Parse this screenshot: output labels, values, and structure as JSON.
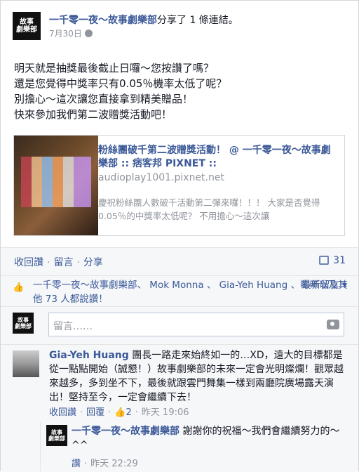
{
  "post": {
    "page_name": "一千零一夜～故事劇樂部",
    "shared_text": "分享了 1 條連結。",
    "date": "7月30日",
    "avatar_text": "故事\n劇樂部",
    "message_lines": [
      "明天就是抽獎最後截止日囉～您按讚了嗎？",
      "還是您覺得中獎率只有0.05％機率太低了呢？",
      "別擔心～這次讓您直接拿到精美贈品！",
      "快來參加我們第二波贈獎活動吧！"
    ]
  },
  "attachment": {
    "title": "粉絲團破千第二波贈獎活動！ @ 一千零一夜～故事劇樂部 :: 痞客邦 PIXNET ::",
    "url": "audioplay1001.pixnet.net",
    "description": "慶祝粉絲團人數破千活動第二彈來囉！！！ 大家是否覺得0.05％的中獎率太低呢？ 不用擔心～這次讓"
  },
  "actions": {
    "unlike": "收回讚",
    "comment": "留言",
    "share": "分享",
    "comment_count": "31"
  },
  "likes": {
    "text_names": "一千零一夜～故事劇樂部、 Mok Monna 、 Gia-Yeh Huang 、咘咘以及其他 73 人都說讚！",
    "newest": "最新留言 ▾"
  },
  "compose": {
    "placeholder": "留言……"
  },
  "comments": [
    {
      "author": "Gia-Yeh Huang",
      "text": "團長一路走來始終如一的…XD，遠大的目標都是從一點點開始（誠懇！）故事劇樂部的未來一定會光明燦爛！觀眾越來越多，多到坐不下，最後就跟雲門舞集一樣到兩廳院廣場露天演出！堅持至今，一定會繼續下去！",
      "unlike": "收回讚",
      "reply": "回覆",
      "likes": "2",
      "time": "昨天 19:06"
    },
    {
      "author": "一千零一夜～故事劇樂部",
      "text": "謝謝你的祝福～我們會繼續努力的～^^",
      "like": "讚",
      "time": "昨天 22:29"
    }
  ]
}
